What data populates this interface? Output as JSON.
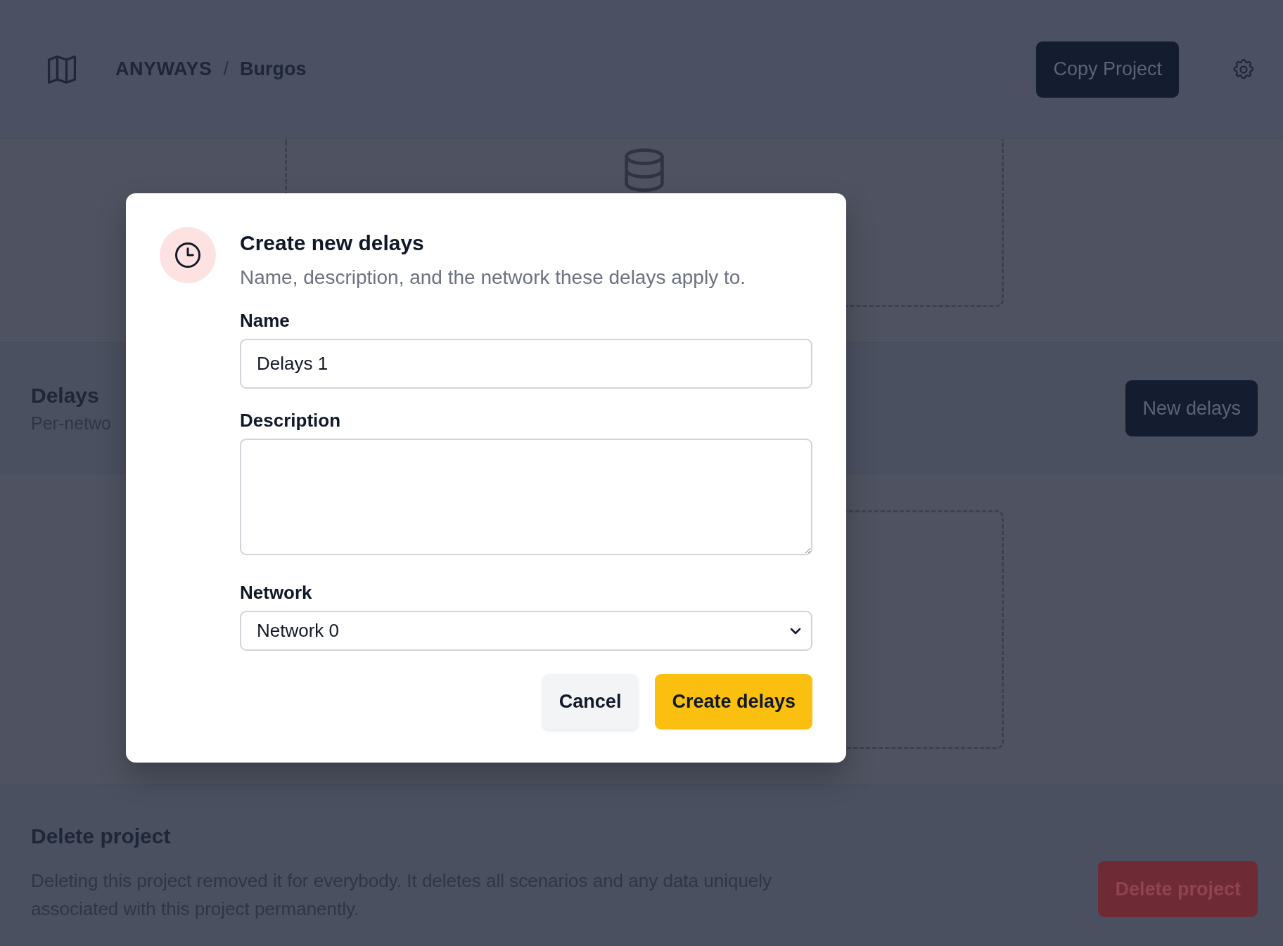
{
  "header": {
    "breadcrumbs": [
      "ANYWAYS",
      "Burgos"
    ],
    "separator": "/",
    "copy_button": "Copy Project"
  },
  "delays_section": {
    "title": "Delays",
    "subtitle": "Per-netwo",
    "button": "New delays"
  },
  "delete_section": {
    "title": "Delete project",
    "description": "Deleting this project removed it for everybody. It deletes all scenarios and any data uniquely associated with this project permanently.",
    "button": "Delete project"
  },
  "modal": {
    "title": "Create new delays",
    "subtitle": "Name, description, and the network these delays apply to.",
    "fields": [
      {
        "kind": "text",
        "label": "Name",
        "value": "Delays 1"
      },
      {
        "kind": "textarea",
        "label": "Description"
      },
      {
        "kind": "select",
        "label": "Network",
        "value": "Network 0"
      }
    ],
    "buttons": [
      {
        "kind": "secondary",
        "label": "Cancel"
      },
      {
        "kind": "primary",
        "label": "Create delays"
      }
    ]
  }
}
